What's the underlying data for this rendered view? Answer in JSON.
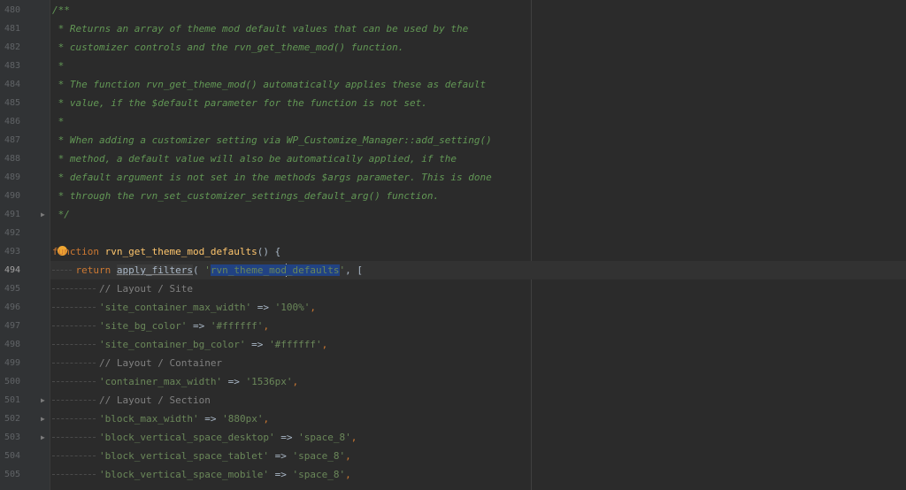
{
  "editor": {
    "current_line": "494",
    "lines": [
      {
        "no": "480",
        "text": "/**"
      },
      {
        "no": "481",
        "text": " * Returns an array of theme mod default values that can be used by the"
      },
      {
        "no": "482",
        "text": " * customizer controls and the rvn_get_theme_mod() function."
      },
      {
        "no": "483",
        "text": " *"
      },
      {
        "no": "484",
        "text": " * The function rvn_get_theme_mod() automatically applies these as default"
      },
      {
        "no": "485",
        "text": " * value, if the $default parameter for the function is not set."
      },
      {
        "no": "486",
        "text": " *"
      },
      {
        "no": "487",
        "text": " * When adding a customizer setting via WP_Customize_Manager::add_setting()"
      },
      {
        "no": "488",
        "text": " * method, a default value will also be automatically applied, if the"
      },
      {
        "no": "489",
        "text": " * default argument is not set in the methods $args parameter. This is done"
      },
      {
        "no": "490",
        "text": " * through the rvn_set_customizer_settings_default_arg() function."
      },
      {
        "no": "491",
        "text": " */"
      },
      {
        "no": "492",
        "text": ""
      },
      {
        "no": "493",
        "keyword": "function",
        "name": "rvn_get_theme_mod_defaults",
        "rest": "() {"
      },
      {
        "no": "494",
        "keyword": "return",
        "call": "apply_filters",
        "open": "( ",
        "q1": "'",
        "hook": "rvn_theme_mod_defaults",
        "q2": "'",
        "rest": ", ["
      },
      {
        "no": "495",
        "comment": "// Layout / Site"
      },
      {
        "no": "496",
        "key": "'site_container_max_width'",
        "arrow": " => ",
        "value": "'100%'",
        "comma": ","
      },
      {
        "no": "497",
        "key": "'site_bg_color'",
        "arrow": " => ",
        "value": "'#ffffff'",
        "comma": ","
      },
      {
        "no": "498",
        "key": "'site_container_bg_color'",
        "arrow": " => ",
        "value": "'#ffffff'",
        "comma": ","
      },
      {
        "no": "499",
        "comment": "// Layout / Container"
      },
      {
        "no": "500",
        "key": "'container_max_width'",
        "arrow": " => ",
        "value": "'1536px'",
        "comma": ","
      },
      {
        "no": "501",
        "comment": "// Layout / Section"
      },
      {
        "no": "502",
        "key": "'block_max_width'",
        "arrow": " => ",
        "value": "'880px'",
        "comma": ","
      },
      {
        "no": "503",
        "key": "'block_vertical_space_desktop'",
        "arrow": " => ",
        "value": "'space_8'",
        "comma": ","
      },
      {
        "no": "504",
        "key": "'block_vertical_space_tablet'",
        "arrow": " => ",
        "value": "'space_8'",
        "comma": ","
      },
      {
        "no": "505",
        "key": "'block_vertical_space_mobile'",
        "arrow": " => ",
        "value": "'space_8'",
        "comma": ","
      }
    ]
  },
  "colors": {
    "background": "#2b2b2b",
    "comment": "#629755",
    "keyword": "#cc7832",
    "function_name": "#ffc66d",
    "string": "#6a8759",
    "selection": "#214283"
  },
  "icons": [
    "fold-arrow-icon",
    "intention-bulb-icon"
  ]
}
